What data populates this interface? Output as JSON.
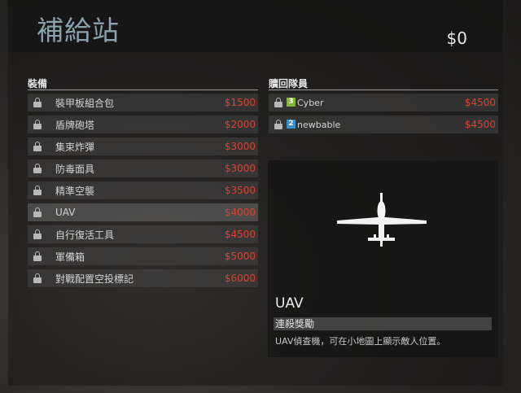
{
  "header": {
    "title": "補給站",
    "money": "$0"
  },
  "equipment": {
    "label": "裝備",
    "items": [
      {
        "name": "裝甲板組合包",
        "price": "$1500"
      },
      {
        "name": "盾牌砲塔",
        "price": "$2000"
      },
      {
        "name": "集束炸彈",
        "price": "$3000"
      },
      {
        "name": "防毒面具",
        "price": "$3000"
      },
      {
        "name": "精準空襲",
        "price": "$3500"
      },
      {
        "name": "UAV",
        "price": "$4000"
      },
      {
        "name": "自行復活工具",
        "price": "$4500"
      },
      {
        "name": "軍備箱",
        "price": "$5000"
      },
      {
        "name": "對戰配置空投標記",
        "price": "$6000"
      }
    ]
  },
  "redeem": {
    "label": "贖回隊員",
    "items": [
      {
        "badge": "3",
        "badge_color": "#7fb83a",
        "name": "Cyber",
        "price": "$4500"
      },
      {
        "badge": "2",
        "badge_color": "#3a8fc4",
        "name": "newbable",
        "price": "$4500"
      }
    ]
  },
  "detail": {
    "name": "UAV",
    "category": "連殺獎勵",
    "description": "UAV偵查機，可在小地圖上顯示敵人位置。",
    "icon": "uav-drone-icon"
  },
  "colors": {
    "price": "#d8432f",
    "title": "#8aa3ad"
  }
}
